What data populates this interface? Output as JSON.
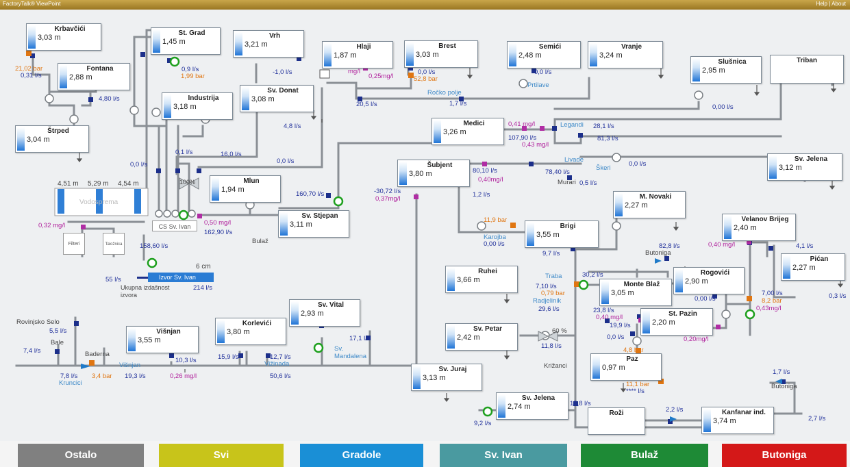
{
  "window": {
    "title": "FactoryTalk® ViewPoint",
    "help": "Help | About"
  },
  "tanks": {
    "krbavcici": {
      "name": "Krbavčići",
      "level": "3,03 m"
    },
    "st_grad": {
      "name": "St. Grad",
      "level": "1,45 m"
    },
    "vrh": {
      "name": "Vrh",
      "level": "3,21 m"
    },
    "hlaji": {
      "name": "Hlaji",
      "level": "1,87 m"
    },
    "brest": {
      "name": "Brest",
      "level": "3,03 m"
    },
    "semici": {
      "name": "Semići",
      "level": "2,48 m"
    },
    "vranje": {
      "name": "Vranje",
      "level": "3,24 m"
    },
    "slusnica": {
      "name": "Slušnica",
      "level": "2,95 m"
    },
    "triban": {
      "name": "Triban",
      "level": ""
    },
    "fontana": {
      "name": "Fontana",
      "level": "2,88 m"
    },
    "industrija": {
      "name": "Industrija",
      "level": "3,18 m"
    },
    "sv_donat": {
      "name": "Sv. Donat",
      "level": "3,08 m"
    },
    "strped": {
      "name": "Štrped",
      "level": "3,04 m"
    },
    "medici": {
      "name": "Medici",
      "level": "3,26 m"
    },
    "subjent": {
      "name": "Šubjent",
      "level": "3,80 m"
    },
    "sv_jelena_e": {
      "name": "Sv. Jelena",
      "level": "3,12 m"
    },
    "mlun": {
      "name": "Mlun",
      "level": "1,94 m"
    },
    "sv_stjepan": {
      "name": "Sv. Stjepan",
      "level": "3,11 m"
    },
    "m_novaki": {
      "name": "M. Novaki",
      "level": "2,27 m"
    },
    "brig": {
      "name": "Brigi",
      "level": "3,55 m"
    },
    "velanov_brijeg": {
      "name": "Velanov Brijeg",
      "level": "2,40 m"
    },
    "pican": {
      "name": "Pićan",
      "level": "2,27 m"
    },
    "ruhei": {
      "name": "Ruhei",
      "level": "3,66 m"
    },
    "monte_blaz": {
      "name": "Monte Blaž",
      "level": "3,05 m"
    },
    "rogovici": {
      "name": "Rogovići",
      "level": "2,90 m"
    },
    "st_pazin": {
      "name": "St. Pazin",
      "level": "2,20 m"
    },
    "sv_vital": {
      "name": "Sv. Vital",
      "level": "2,93 m"
    },
    "korlevici": {
      "name": "Korlevići",
      "level": "3,80 m"
    },
    "visnjan": {
      "name": "Višnjan",
      "level": "3,55 m"
    },
    "sv_petar": {
      "name": "Sv. Petar",
      "level": "2,42 m"
    },
    "paz": {
      "name": "Paz",
      "level": "0,97 m"
    },
    "sv_juraj": {
      "name": "Sv. Juraj",
      "level": "3,13 m"
    },
    "sv_jelena_s": {
      "name": "Sv. Jelena",
      "level": "2,74 m"
    },
    "rozi": {
      "name": "Roži",
      "level": ""
    },
    "kanfanar": {
      "name": "Kanfanar ind.",
      "level": "3,74 m"
    }
  },
  "vodosprema": {
    "title": "Vodosprema",
    "l1": "4,51 m",
    "l2": "5,29 m",
    "l3": "4,54 m",
    "chem": "0,32 mg/l"
  },
  "boxes": {
    "filteri": "Filteri",
    "talozenje": "Taložnica",
    "cs": "CS Sv. Ivan"
  },
  "izvor": {
    "name": "Izvor Sv. Ivan",
    "depth": "6 cm",
    "flow_in": "158,60 l/s",
    "out1": "55 l/s",
    "total_label": "Ukupna izdašnost izvora",
    "total": "214 l/s"
  },
  "labels": {
    "krb_bar": "21,02 bar",
    "krb_flow": "0,31 l/s",
    "stg_flow": "0,9 l/s",
    "stg_bar": "1,99 bar",
    "vrh_flow": "-1,0 l/s",
    "hlaji_mg": "mg/l",
    "hlaji_flow": "20,5 l/s",
    "brest_mg": "0,25mg/l",
    "brest_flow": "0,0 l/s",
    "brest_bar": "52,8 bar",
    "semici_flow": "0,0 l/s",
    "prtilave": "Prtilave",
    "rocko_polje": "Ročko polje",
    "rocko_flow": "1,7 l/s",
    "slusnica_flow": "0,00 l/s",
    "fontana_flow": "4,80 l/s",
    "donat_flow": "4,8 l/s",
    "f_00a": "0,0 l/s",
    "f_01": "0,1 l/s",
    "f_160": "16,0 l/s",
    "f_00b": "0,0 l/s",
    "medici_mg1": "0,41 mg/l",
    "medici_flow": "107,90 l/s",
    "medici_mg2": "0,43 mg/l",
    "legandi": "Legandi",
    "legandi_flow": "28,1 l/s",
    "f_813": "81,3 l/s",
    "livade": "Livade",
    "livade_flow": "78,40 l/s",
    "skeri": "Škeri",
    "skeri_flow": "0,0 l/s",
    "murari": "Murari",
    "murari_flow": "0,5 l/s",
    "subj_flow": "80,10 l/s",
    "subj_mg": "0,40mg/l",
    "subj_f2": "-30,72 l/s",
    "subj_mg2": "0,37mg/l",
    "subj_f3": "1,2 l/s",
    "pct100": "100%",
    "f_16070": "160,70 l/s",
    "cs_mg": "0,50 mg/l",
    "cs_flow": "162,90 l/s",
    "bulaz": "Bulaž",
    "karojba_bar": "11,9 bar",
    "karojba": "Karojba",
    "karojba_flow": "0,00 l/s",
    "brig_flow": "9,7 l/s",
    "velanov_mg": "0,40 mg/l",
    "velanov_flow": "4,1 l/s",
    "pican_flow": "0,3 l/s",
    "butoniga_flow": "82,8 l/s",
    "butoniga": "Butoniga",
    "traba": "Traba",
    "traba_flow": "7,10 l/s",
    "traba_bar": "0,79 bar",
    "radjelinik": "Radjelinik",
    "radj_flow": "29,6 l/s",
    "f_302": "30,2 l/s",
    "mb_f1": "23,8 l/s",
    "mb_mg": "0,40 mg/l",
    "mb_f2": "19,9 l/s",
    "rog_flow": "0,00 l/s",
    "rog_f2": "7,00 l/s",
    "rog_bar": "8,2 bar",
    "rog_mg": "0,43mg/l",
    "stp_flow": "0,0 l/s",
    "stp_mg": "0,20mg/l",
    "paz_bar": "4,8 bar",
    "paz_bar2": "11,1 bar",
    "paz_flow": "**** l/s",
    "petar_pct": "60 %",
    "petar_flow": "11,8 l/s",
    "krizanci": "Križanci",
    "vital_flow": "17,1 l/s",
    "mandalena": "Sv. Mandalena",
    "korl_flow": "15,9 l/s",
    "korl_f2": "12,7 l/s",
    "vizinada": "Vižinada",
    "viz_flow": "50,6 l/s",
    "visnjan_flow": "10,3 l/s",
    "visnjan_mg": "0,26 mg/l",
    "visnjan_lbl": "Višnjan",
    "visnjan_f2": "19,3 l/s",
    "rovinjsko": "Rovinjsko Selo",
    "rov_flow": "5,5 l/s",
    "bale": "Bale",
    "bale_flow": "7,4 l/s",
    "baderna": "Baderna",
    "baderna_bar": "3,4 bar",
    "kruncici_flow": "7,8 l/s",
    "kruncici": "Kruncici",
    "juraj_flow": "9,2 l/s",
    "jelena_flow": "15,8 l/s",
    "rozi_flow": "2,2 l/s",
    "butoniga2": "Butoniga",
    "but2_flow": "1,7 l/s",
    "kanfanar_flow": "2,7 l/s"
  },
  "bottom": {
    "ostalo": "Ostalo",
    "svi": "Svi",
    "gradole": "Gradole",
    "sv_ivan": "Sv. Ivan",
    "bulaz": "Bulaž",
    "butoniga": "Butoniga"
  },
  "colors": {
    "ostalo": "#808080",
    "svi": "#c8c41a",
    "gradole": "#1a8fd6",
    "sv_ivan": "#4a9aa0",
    "bulaz": "#1e8a36",
    "butoniga": "#d41818"
  }
}
